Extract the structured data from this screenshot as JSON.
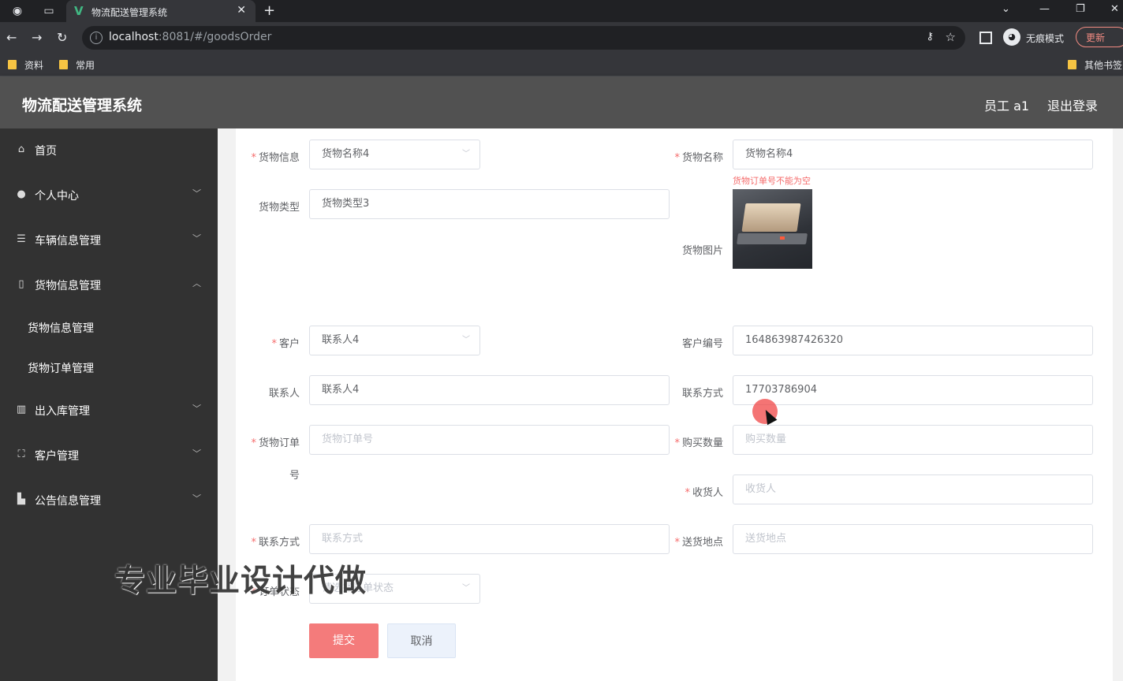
{
  "browser": {
    "tab_title": "物流配送管理系统",
    "url_host": "localhost",
    "url_path": ":8081/#/goodsOrder",
    "incognito_label": "无痕模式",
    "update_label": "更新",
    "bookmarks": [
      "资料",
      "常用"
    ],
    "other_bookmarks": "其他书签"
  },
  "header": {
    "title": "物流配送管理系统",
    "user": "员工 a1",
    "logout": "退出登录"
  },
  "sidebar": {
    "items": [
      {
        "label": "首页",
        "icon": "home-icon"
      },
      {
        "label": "个人中心",
        "icon": "user-icon"
      },
      {
        "label": "车辆信息管理",
        "icon": "sliders-icon"
      },
      {
        "label": "货物信息管理",
        "icon": "phone-icon"
      },
      {
        "label": "出入库管理",
        "icon": "books-icon"
      },
      {
        "label": "客户管理",
        "icon": "frame-icon"
      },
      {
        "label": "公告信息管理",
        "icon": "chart-icon"
      }
    ],
    "subitems": [
      "货物信息管理",
      "货物订单管理"
    ]
  },
  "form": {
    "goods_info": {
      "label": "货物信息",
      "value": "货物名称4"
    },
    "goods_name": {
      "label": "货物名称",
      "value": "货物名称4",
      "error": "货物订单号不能为空"
    },
    "goods_type": {
      "label": "货物类型",
      "value": "货物类型3"
    },
    "goods_image": {
      "label": "货物图片"
    },
    "customer": {
      "label": "客户",
      "value": "联系人4"
    },
    "customer_no": {
      "label": "客户编号",
      "value": "164863987426320"
    },
    "contact": {
      "label": "联系人",
      "value": "联系人4"
    },
    "contact_phone": {
      "label": "联系方式",
      "value": "17703786904"
    },
    "order_no": {
      "label_line1": "货物订单",
      "label_line2": "号",
      "placeholder": "货物订单号"
    },
    "quantity": {
      "label": "购买数量",
      "placeholder": "购买数量"
    },
    "receiver": {
      "label": "收货人",
      "placeholder": "收货人"
    },
    "receiver_phone": {
      "label": "联系方式",
      "placeholder": "联系方式"
    },
    "address": {
      "label": "送货地点",
      "placeholder": "送货地点"
    },
    "order_status": {
      "label": "订单状态",
      "placeholder": "请选择订单状态"
    },
    "submit": "提交",
    "cancel": "取消"
  },
  "watermark": "专业毕业设计代做",
  "colors": {
    "accent": "#f47b7b",
    "sidebar": "#323232",
    "header": "#515151",
    "error": "#f56c6c"
  }
}
